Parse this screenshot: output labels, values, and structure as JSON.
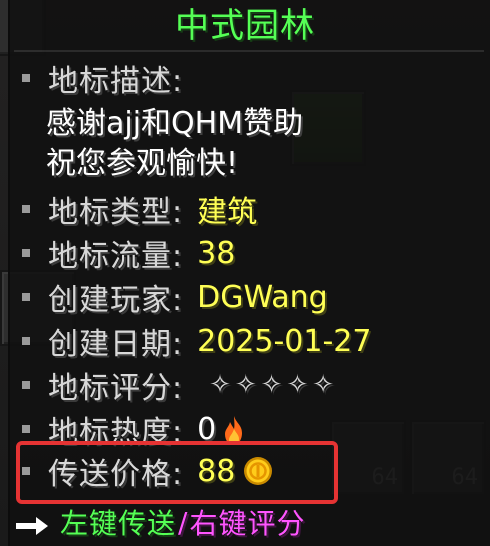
{
  "title": "中式园林",
  "description": {
    "label": "地标描述:",
    "lines": [
      "感谢ajj和QHM赞助",
      "祝您参观愉快!"
    ]
  },
  "fields": {
    "type": {
      "label": "地标类型:",
      "value": "建筑"
    },
    "traffic": {
      "label": "地标流量:",
      "value": "38"
    },
    "creator": {
      "label": "创建玩家:",
      "value": "DGWang"
    },
    "created": {
      "label": "创建日期:",
      "value": "2025-01-27"
    },
    "rating": {
      "label": "地标评分:",
      "value": "✧✧✧✧✧",
      "stars_filled": 0,
      "stars_total": 5
    },
    "heat": {
      "label": "地标热度:",
      "value": "0",
      "icon": "fire-icon"
    },
    "price": {
      "label": "传送价格:",
      "value": "88",
      "icon": "coin-icon"
    }
  },
  "actions": {
    "left": "左键传送",
    "separator": "/",
    "right": "右键评分",
    "icon": "arrow-right-icon"
  },
  "background": {
    "slot_counts": [
      "64",
      "64"
    ]
  },
  "colors": {
    "title": "#55ff55",
    "value": "#ffff55",
    "label": "#d8d8d8",
    "left_action": "#55ff55",
    "right_action": "#ff55ff",
    "highlight": "#e53333"
  }
}
